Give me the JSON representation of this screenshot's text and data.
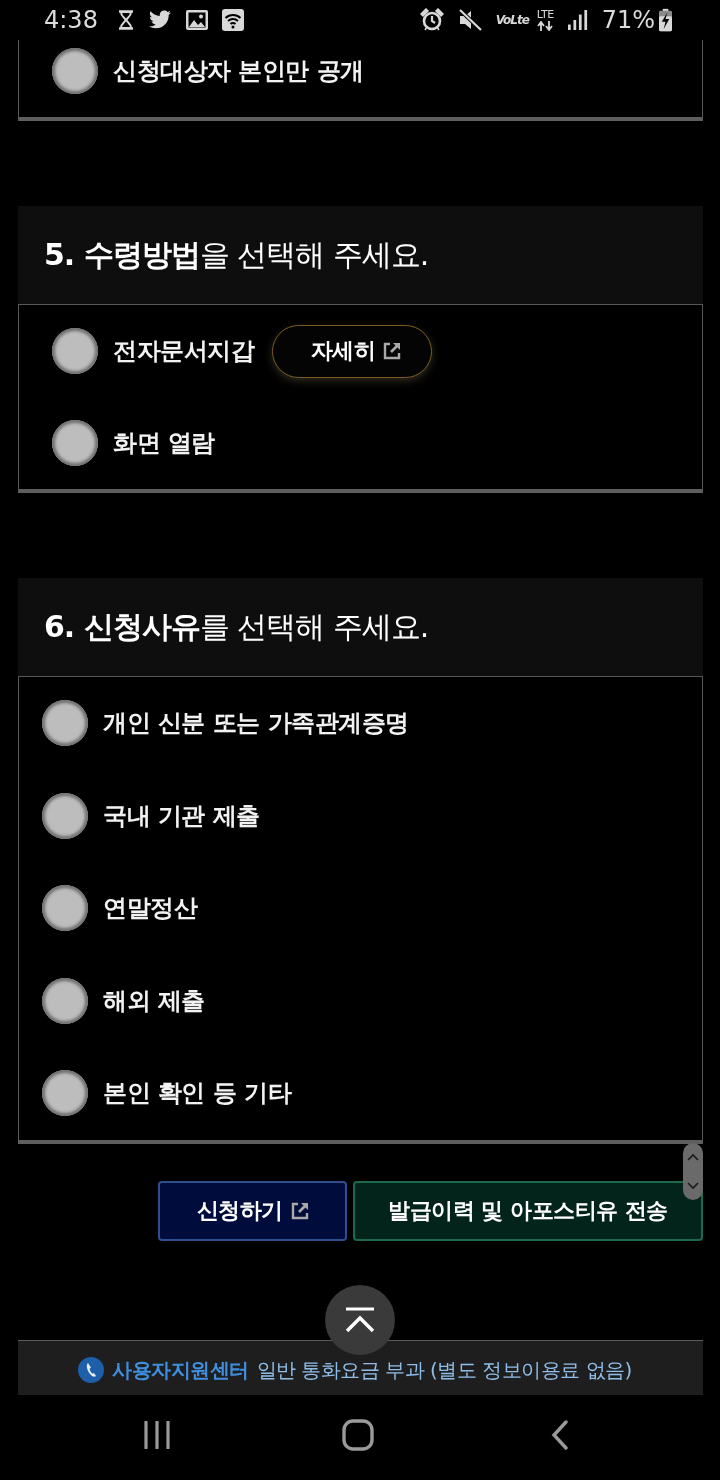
{
  "status_bar": {
    "time": "4:38",
    "volte": "VoLte",
    "network": "LTE",
    "battery": "71%"
  },
  "sections": [
    {
      "options": [
        {
          "label": "신청대상자 본인만 공개",
          "selected": false
        }
      ]
    },
    {
      "title": "**5. 수령방법**을 선택해 주세요.",
      "options": [
        {
          "label": "전자문서지갑",
          "selected": false,
          "detail_button": {
            "label": "자세히",
            "external": true
          }
        },
        {
          "label": "화면 열람",
          "selected": false
        }
      ]
    },
    {
      "title": "**6. 신청사유**를 선택해 주세요.",
      "options": [
        {
          "label": "개인 신분 또는 가족관계증명",
          "selected": false
        },
        {
          "label": "국내 기관 제출",
          "selected": false
        },
        {
          "label": "연말정산",
          "selected": false
        },
        {
          "label": "해외 제출",
          "selected": false
        },
        {
          "label": "본인 확인 등 기타",
          "selected": false
        }
      ]
    }
  ],
  "actions": [
    {
      "label": "신청하기",
      "kind": "primary",
      "external": true
    },
    {
      "label": "발급이력 및 아포스티유 전송",
      "kind": "secondary",
      "external": false
    }
  ],
  "footer": {
    "title": "사용자지원센터",
    "note": "일반 통화요금 부과 (별도 정보이용료 없음)"
  }
}
